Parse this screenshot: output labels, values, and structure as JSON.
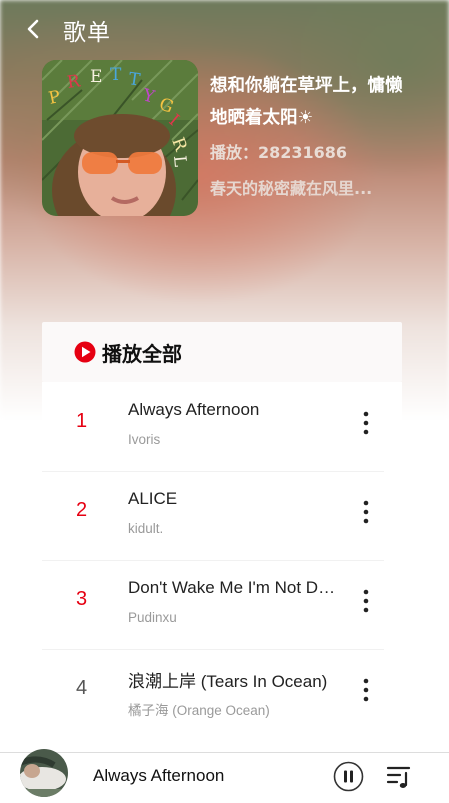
{
  "header": {
    "title": "歌单",
    "back_icon": "chevron-left-icon"
  },
  "playlist": {
    "title": "想和你躺在草坪上，慵懒地晒着太阳☀",
    "play_count": "播放：28231686",
    "description": "春天的秘密藏在风里...",
    "cover_text": [
      "P",
      "R",
      "E",
      "T",
      "T",
      "Y",
      "G",
      "I",
      "R",
      "L"
    ]
  },
  "play_all": {
    "label": "播放全部",
    "icon": "play-circle-icon",
    "accent": "#e60012"
  },
  "songs": [
    {
      "index": "1",
      "title": "Always Afternoon",
      "artist": "Ivoris",
      "index_color": "#e60012"
    },
    {
      "index": "2",
      "title": "ALICE",
      "artist": "kidult.",
      "index_color": "#e60012"
    },
    {
      "index": "3",
      "title": "Don't Wake Me I'm Not Dreaming",
      "artist": "Pudinxu",
      "index_color": "#e60012"
    },
    {
      "index": "4",
      "title": "浪潮上岸 (Tears In Ocean)",
      "artist": "橘子海 (Orange Ocean)",
      "index_color": "#555555"
    }
  ],
  "mini_player": {
    "title": "Always Afternoon",
    "pause_icon": "pause-icon",
    "queue_icon": "playlist-queue-icon"
  }
}
